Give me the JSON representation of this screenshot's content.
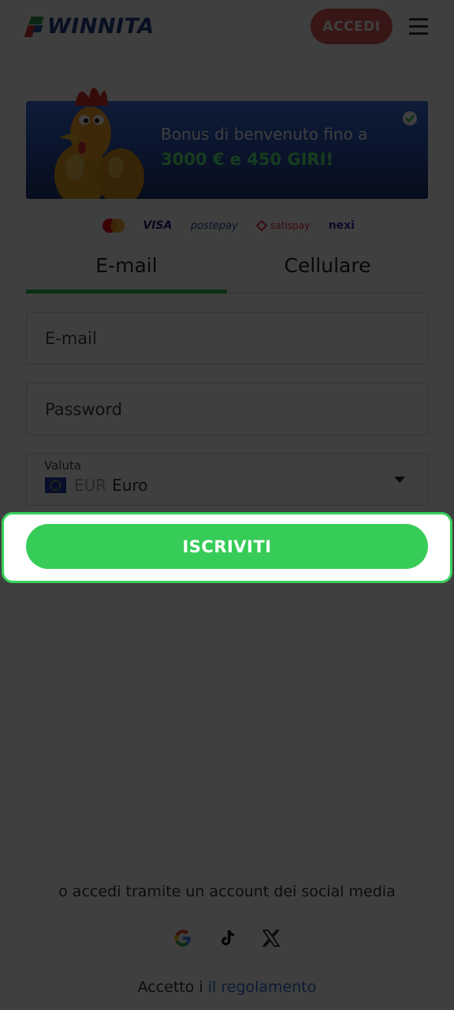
{
  "header": {
    "logo_text": "WINNITA",
    "login_label": "ACCEDI",
    "menu_icon": "hamburger-menu-icon"
  },
  "banner": {
    "line1": "Bonus di benvenuto fino a",
    "line2": "3000 € e 450 GIRI!",
    "image": "rooster-with-golden-eggs",
    "check_icon": "check-icon"
  },
  "payments": [
    "mastercard",
    "VISA",
    "postepay",
    "satispay",
    "nexi"
  ],
  "tabs": [
    {
      "label": "E-mail",
      "active": true
    },
    {
      "label": "Cellulare",
      "active": false
    }
  ],
  "form": {
    "email_placeholder": "E-mail",
    "password_placeholder": "Password",
    "currency_label": "Valuta",
    "currency_code": "EUR",
    "currency_name": "Euro",
    "register_label": "ISCRIVITI"
  },
  "social": {
    "prompt": "o accedi tramite un account dei social media",
    "icons": [
      "google-icon",
      "tiktok-icon",
      "x-icon"
    ]
  },
  "terms": {
    "prefix": "Accetto i",
    "link": "il regolamento"
  },
  "colors": {
    "brand_blue": "#1f3e86",
    "accent_green": "#37cc58",
    "login_red": "#e25a5a",
    "link_blue": "#2f6fcf"
  }
}
